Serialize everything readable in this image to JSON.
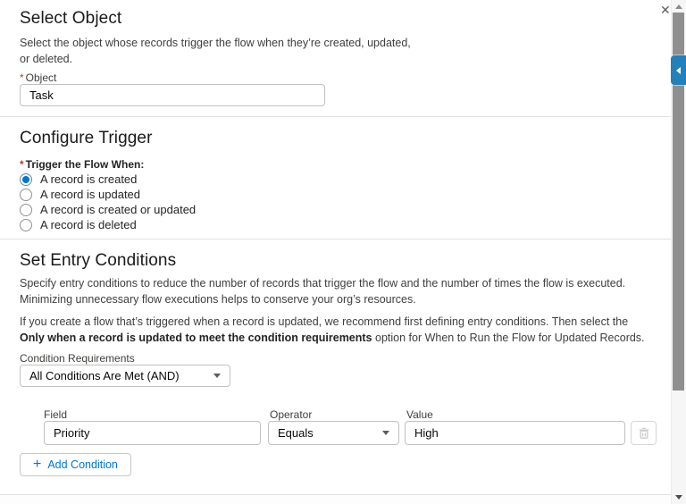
{
  "window": {
    "close_icon": "✕"
  },
  "select_object": {
    "title": "Select Object",
    "description_line1": "Select the object whose records trigger the flow when they’re created, updated,",
    "description_line2": "or deleted.",
    "required_mark": "*",
    "object_label": "Object",
    "object_value": "Task"
  },
  "configure_trigger": {
    "title": "Configure Trigger",
    "required_mark": "*",
    "trigger_label": "Trigger the Flow When:",
    "options": [
      {
        "label": "A record is created",
        "selected": true
      },
      {
        "label": "A record is updated",
        "selected": false
      },
      {
        "label": "A record is created or updated",
        "selected": false
      },
      {
        "label": "A record is deleted",
        "selected": false
      }
    ]
  },
  "entry_conditions": {
    "title": "Set Entry Conditions",
    "description1_line1": "Specify entry conditions to reduce the number of records that trigger the flow and the number of times the flow is executed.",
    "description1_line2": "Minimizing unnecessary flow executions helps to conserve your org’s resources.",
    "description2_line1": "If you create a flow that’s triggered when a record is updated, we recommend first defining entry conditions. Then select the",
    "description2_bold": "Only when a record is updated to meet the condition requirements",
    "description2_rest": " option for When to Run the Flow for Updated Records.",
    "condition_requirements_label": "Condition Requirements",
    "condition_requirements_value": "All Conditions Are Met (AND)",
    "condition": {
      "field_label": "Field",
      "field_value": "Priority",
      "operator_label": "Operator",
      "operator_value": "Equals",
      "value_label": "Value",
      "value_value": "High"
    },
    "add_condition": {
      "plus_icon": "+",
      "label": "Add Condition"
    }
  },
  "colors": {
    "accent": "#0176d3",
    "required": "#c23934"
  }
}
